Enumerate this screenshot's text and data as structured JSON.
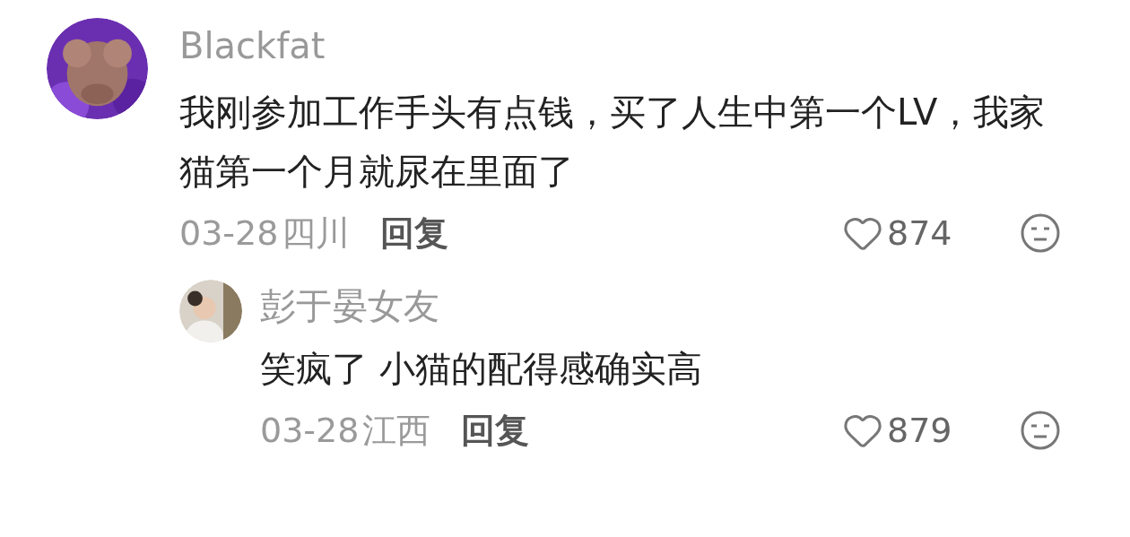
{
  "comments": [
    {
      "author": "Blackfat",
      "text": "我刚参加工作手头有点钱，买了人生中第一个LV，我家猫第一个月就尿在里面了",
      "date": "03-28",
      "location": "四川",
      "reply_label": "回复",
      "likes": "874",
      "replies": [
        {
          "author": "彭于晏女友",
          "text": "笑疯了 小猫的配得感确实高",
          "date": "03-28",
          "location": "江西",
          "reply_label": "回复",
          "likes": "879"
        }
      ]
    }
  ]
}
